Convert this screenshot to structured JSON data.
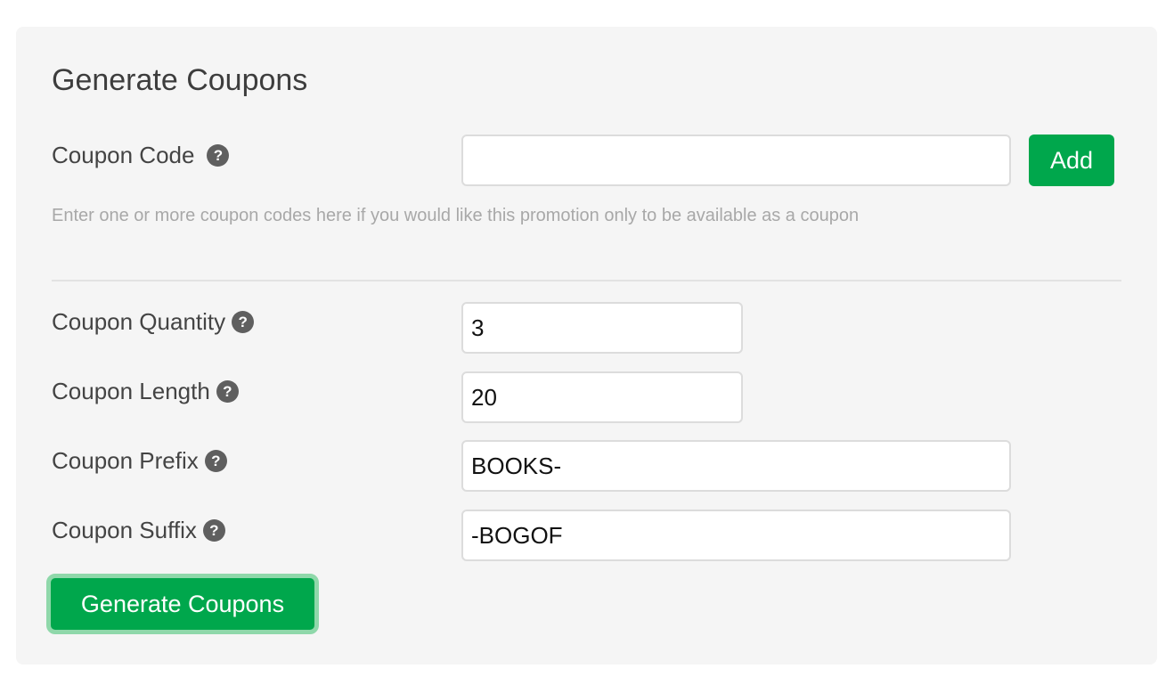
{
  "form": {
    "title": "Generate Coupons",
    "coupon_code": {
      "label": "Coupon Code",
      "value": "",
      "add_label": "Add",
      "hint": "Enter one or more coupon codes here if you would like this promotion only to be available as a coupon"
    },
    "coupon_quantity": {
      "label": "Coupon Quantity",
      "value": "3"
    },
    "coupon_length": {
      "label": "Coupon Length",
      "value": "20"
    },
    "coupon_prefix": {
      "label": "Coupon Prefix",
      "value": "BOOKS-"
    },
    "coupon_suffix": {
      "label": "Coupon Suffix",
      "value": "-BOGOF"
    },
    "generate_label": "Generate Coupons",
    "help_glyph": "?",
    "help_icon": "question-circle-icon"
  },
  "colors": {
    "primary_green": "#00a74c",
    "focus_ring": "#8fd8aa",
    "panel_bg": "#f5f5f5",
    "icon_gray": "#5f5f5f"
  }
}
